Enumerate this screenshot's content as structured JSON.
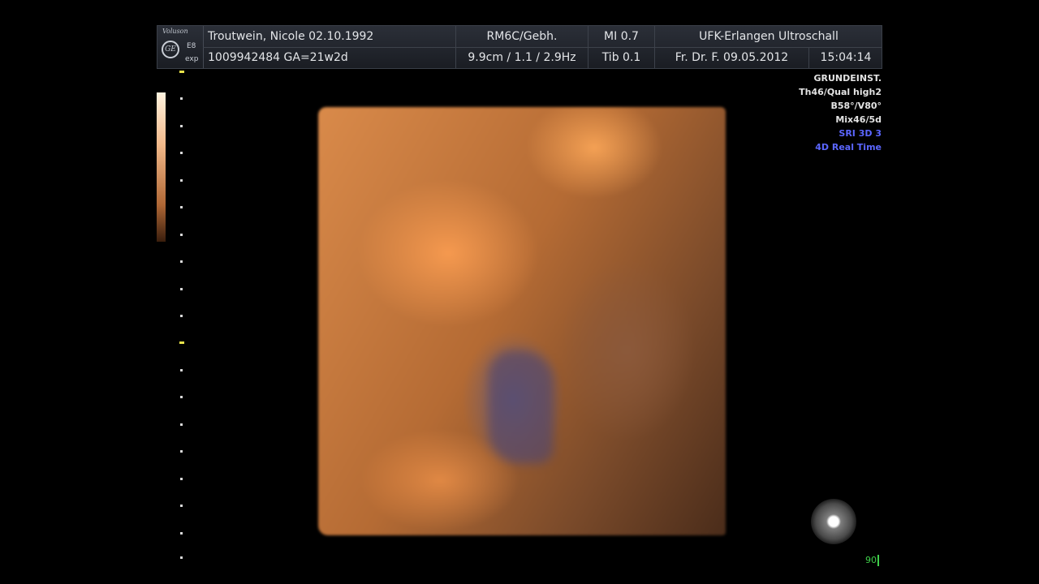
{
  "header": {
    "logo": {
      "brand": "Voluson",
      "ge": "GE",
      "model": "E8",
      "exp": "exp"
    },
    "row1": {
      "patient": "Troutwein, Nicole 02.10.1992",
      "probe": "RM6C/Gebh.",
      "mi": "MI  0.7",
      "institution": "UFK-Erlangen Ultroschall"
    },
    "row2": {
      "id_ga": "1009942484 GA=21w2d",
      "depth_freq": "9.9cm / 1.1 / 2.9Hz",
      "tib": "Tib  0.1",
      "operator_date": "Fr. Dr. F.  09.05.2012",
      "time": "15:04:14"
    }
  },
  "info_panel": {
    "lines": [
      "GRUNDEINST.",
      "Th46/Qual high2",
      "B58°/V80°",
      "Mix46/5d"
    ],
    "blue_lines": [
      "SRI 3D 3",
      "4D Real Time"
    ]
  },
  "badge": "90",
  "colors": {
    "accent_blue": "#5b66ff",
    "badge_green": "#3fd04a"
  }
}
